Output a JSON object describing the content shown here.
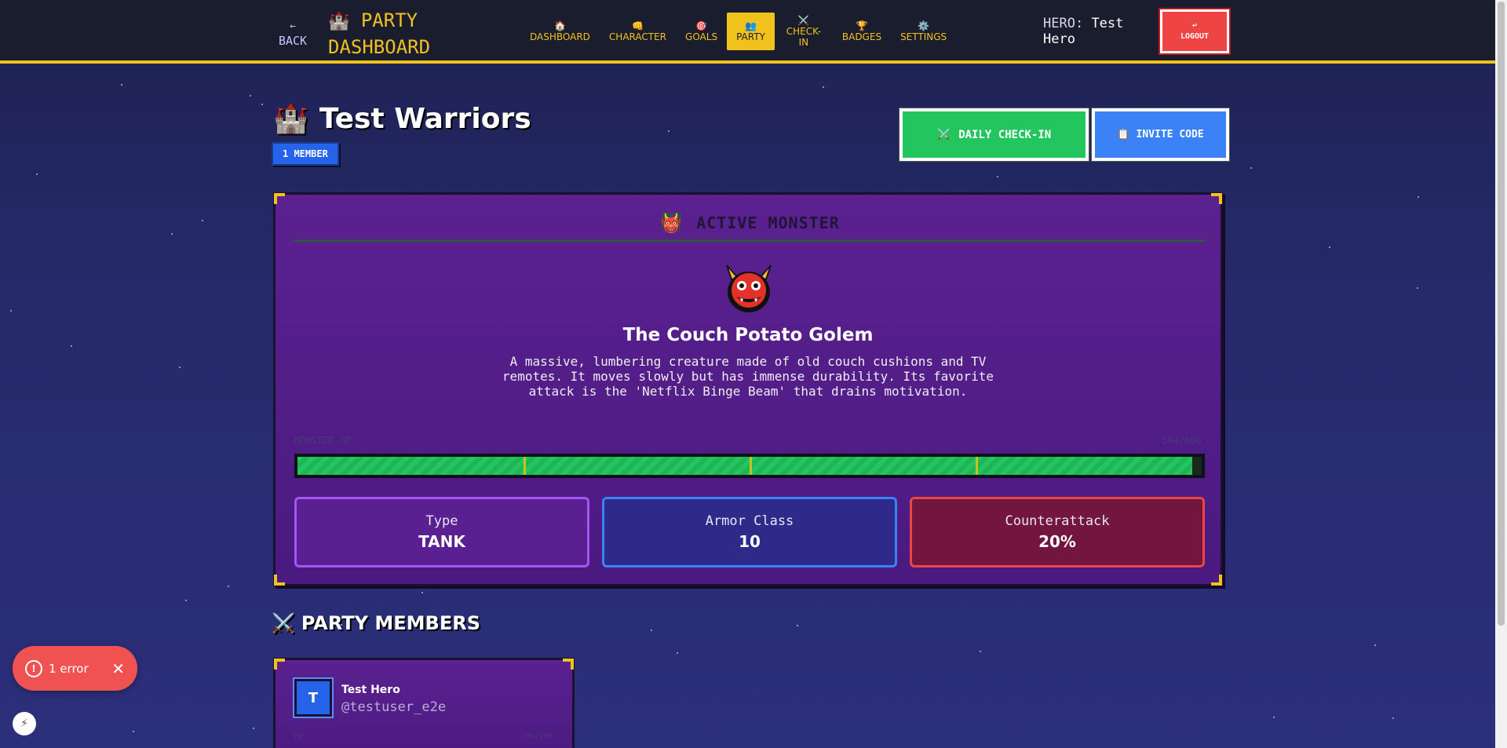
{
  "header": {
    "back_arrow": "←",
    "back_label": "BACK",
    "brand_icon": "🏰",
    "brand_line1": "PARTY",
    "brand_line2": "DASHBOARD",
    "nav": [
      {
        "icon": "🏠",
        "label": "DASHBOARD"
      },
      {
        "icon": "👊",
        "label": "CHARACTER"
      },
      {
        "icon": "🎯",
        "label": "GOALS"
      },
      {
        "icon": "👥",
        "label": "PARTY"
      },
      {
        "icon": "⚔️",
        "label": "CHECK-IN"
      },
      {
        "icon": "🏆",
        "label": "BADGES"
      },
      {
        "icon": "⚙️",
        "label": "SETTINGS"
      }
    ],
    "hero_prefix": "HERO:",
    "hero_name": "Test Hero",
    "logout_icon": "↩",
    "logout_label": "LOGOUT"
  },
  "party": {
    "icon": "🏰",
    "name": "Test Warriors",
    "member_count": "1 MEMBER",
    "checkin_icon": "⚔️",
    "checkin_label": "DAILY CHECK-IN",
    "invite_icon": "📋",
    "invite_label": "INVITE CODE"
  },
  "monster": {
    "header_icon": "👹",
    "header": "ACTIVE MONSTER",
    "name": "The Couch Potato Golem",
    "description": "A massive, lumbering creature made of old couch cushions and TV remotes. It moves slowly but has immense durability. Its favorite attack is the 'Netflix Binge Beam' that drains motivation.",
    "hp_label": "MONSTER HP",
    "hp_text": "594/600",
    "hp_fraction": 0.99,
    "stats": [
      {
        "label": "Type",
        "value": "TANK"
      },
      {
        "label": "Armor Class",
        "value": "10"
      },
      {
        "label": "Counterattack",
        "value": "20%"
      }
    ]
  },
  "members_section": {
    "icon": "⚔️",
    "title": "PARTY MEMBERS",
    "members": [
      {
        "initial": "T",
        "name": "Test Hero",
        "username": "@testuser_e2e",
        "hp_label": "HP",
        "hp_text": "100/100"
      }
    ]
  },
  "error_toast": {
    "icon": "!",
    "text": "1 error",
    "close": "✕"
  },
  "colors": {
    "accent": "#f2c21c",
    "checkin": "#22c55e",
    "invite": "#3b82f6",
    "logout": "#ef4444"
  }
}
